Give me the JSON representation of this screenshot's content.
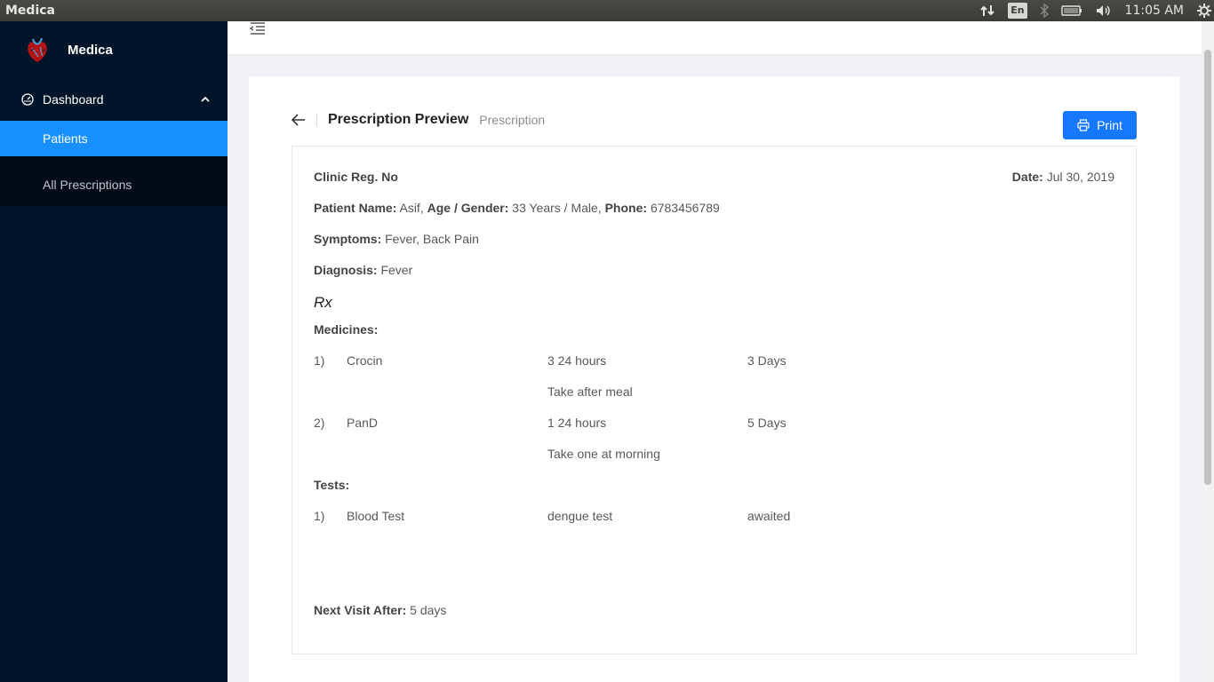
{
  "os": {
    "window_title": "Medica",
    "lang": "En",
    "clock": "11:05 AM"
  },
  "sidebar": {
    "brand": "Medica",
    "menu": {
      "dashboard_label": "Dashboard",
      "items": [
        {
          "label": "Patients",
          "active": true
        },
        {
          "label": "All Prescriptions",
          "active": false
        }
      ]
    }
  },
  "page": {
    "title": "Prescription Preview",
    "subtitle": "Prescription",
    "print_label": "Print"
  },
  "prescription": {
    "clinic_reg_label": "Clinic Reg. No",
    "date_label": "Date:",
    "date_value": "Jul 30, 2019",
    "patient_name_label": "Patient Name:",
    "patient_name_value": "Asif,",
    "age_gender_label": "Age / Gender:",
    "age_gender_value": "33 Years / Male,",
    "phone_label": "Phone:",
    "phone_value": "6783456789",
    "symptoms_label": "Symptoms:",
    "symptoms_value": "Fever, Back Pain",
    "diagnosis_label": "Diagnosis:",
    "diagnosis_value": "Fever",
    "rx_symbol": "Rx",
    "medicines_label": "Medicines:",
    "medicines": [
      {
        "index": "1)",
        "name": "Crocin",
        "dosage": "3 24 hours",
        "duration": "3 Days",
        "note": "Take after meal"
      },
      {
        "index": "2)",
        "name": "PanD",
        "dosage": "1 24 hours",
        "duration": "5 Days",
        "note": "Take one at morning"
      }
    ],
    "tests_label": "Tests:",
    "tests": [
      {
        "index": "1)",
        "name": "Blood Test",
        "detail": "dengue test",
        "status": "awaited"
      }
    ],
    "next_visit_label": "Next Visit After:",
    "next_visit_value": "5 days"
  },
  "colors": {
    "sidebar_bg": "#001529",
    "submenu_bg": "#000c17",
    "active_item": "#1890ff",
    "primary_button": "#1677ff"
  },
  "icons": [
    "medica-logo-icon",
    "dashboard-icon",
    "chevron-up-icon",
    "menu-fold-icon",
    "arrow-left-icon",
    "printer-icon",
    "network-icon",
    "bluetooth-icon",
    "battery-icon",
    "volume-icon",
    "settings-gear-icon"
  ]
}
